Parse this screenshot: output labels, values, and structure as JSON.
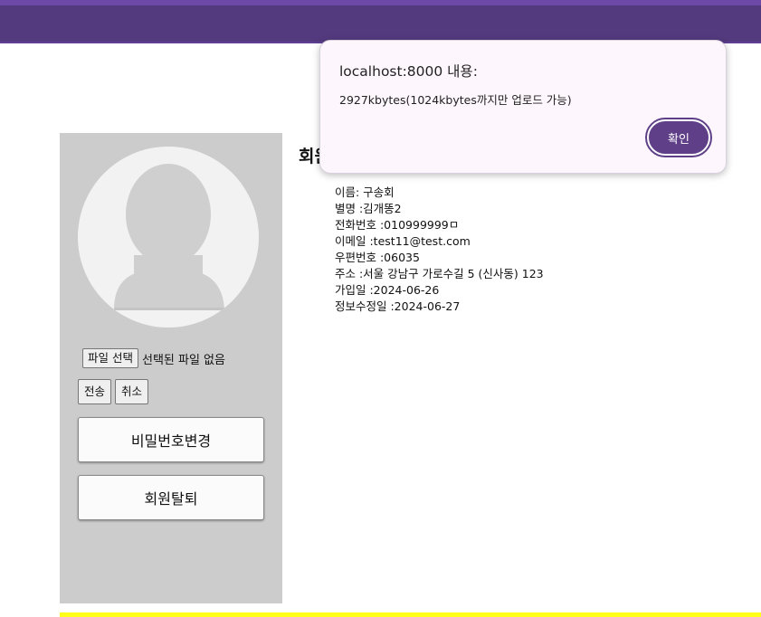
{
  "colors": {
    "header": "#533a7e",
    "sidebar": "#cdcccc",
    "footer_line": "#ffff1a",
    "dialog_button": "#5e3f88"
  },
  "sidebar": {
    "avatar_icon": "default-user-silhouette",
    "file_button": "파일 선택",
    "file_status": "선택된 파일 없음",
    "submit_button": "전송",
    "cancel_button": "취소",
    "change_password_button": "비밀번호변경",
    "withdraw_button": "회원탈퇴"
  },
  "main": {
    "title": "회원정보",
    "info": {
      "name": "이름: 구송회",
      "nickname": "별명 :김개똥2",
      "phone": "전화번호 :010999999ㅁ",
      "email": "이메일 :test11@test.com",
      "zipcode": "우편번호 :06035",
      "address": "주소 :서울 강남구 가로수길 5 (신사동) 123",
      "joined": "가입일 :2024-06-26",
      "modified": "정보수정일 :2024-06-27"
    }
  },
  "dialog": {
    "title": "localhost:8000 내용:",
    "message": "2927kbytes(1024kbytes까지만 업로드 가능)",
    "ok_button": "확인"
  }
}
